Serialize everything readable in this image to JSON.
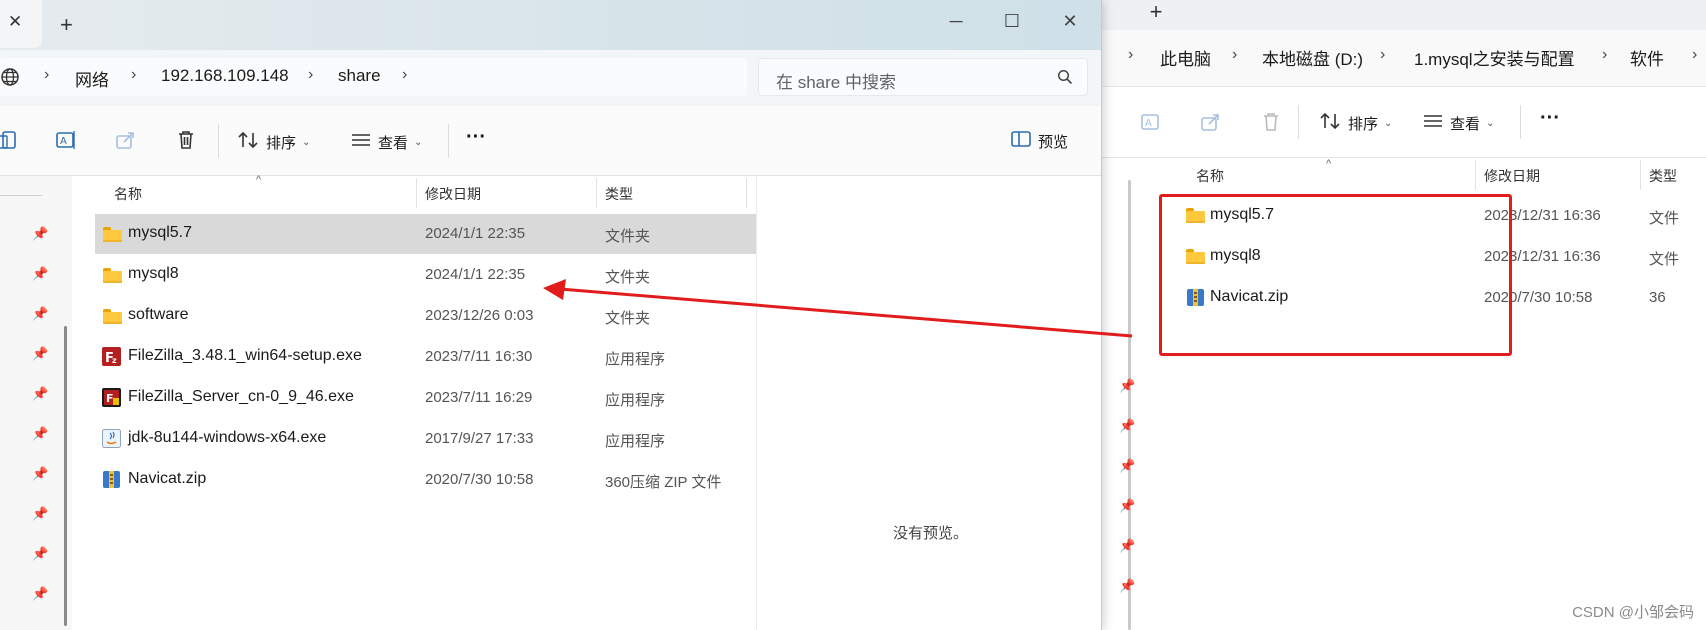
{
  "right_window": {
    "tab_add": "+",
    "breadcrumbs": [
      "此电脑",
      "本地磁盘 (D:)",
      "1.mysql之安装与配置",
      "软件"
    ],
    "toolbar": {
      "sort_label": "排序",
      "view_label": "查看",
      "more_label": "···"
    },
    "columns": {
      "name": "名称",
      "date": "修改日期",
      "type": "类型"
    },
    "rows": [
      {
        "name": "mysql5.7",
        "date": "2023/12/31 16:36",
        "type": "文件",
        "icon": "folder-icon"
      },
      {
        "name": "mysql8",
        "date": "2023/12/31 16:36",
        "type": "文件",
        "icon": "folder-icon"
      },
      {
        "name": "Navicat.zip",
        "date": "2020/7/30 10:58",
        "type": "36",
        "icon": "zip-icon"
      }
    ]
  },
  "left_window": {
    "tab_close": "✕",
    "tab_add": "+",
    "window_controls": {
      "minimize": "─",
      "maximize": "☐",
      "close": "✕"
    },
    "breadcrumbs": [
      "网络",
      "192.168.109.148",
      "share"
    ],
    "search": {
      "placeholder": "在 share 中搜索"
    },
    "toolbar": {
      "sort_label": "排序",
      "view_label": "查看",
      "more_label": "···",
      "preview_label": "预览"
    },
    "columns": {
      "name": "名称",
      "date": "修改日期",
      "type": "类型"
    },
    "rows": [
      {
        "name": "mysql5.7",
        "date": "2024/1/1 22:35",
        "type": "文件夹",
        "icon": "folder-icon",
        "selected": true
      },
      {
        "name": "mysql8",
        "date": "2024/1/1 22:35",
        "type": "文件夹",
        "icon": "folder-icon"
      },
      {
        "name": "software",
        "date": "2023/12/26 0:03",
        "type": "文件夹",
        "icon": "folder-icon"
      },
      {
        "name": "FileZilla_3.48.1_win64-setup.exe",
        "date": "2023/7/11 16:30",
        "type": "应用程序",
        "icon": "filezilla-icon"
      },
      {
        "name": "FileZilla_Server_cn-0_9_46.exe",
        "date": "2023/7/11 16:29",
        "type": "应用程序",
        "icon": "filezilla-server-icon"
      },
      {
        "name": "jdk-8u144-windows-x64.exe",
        "date": "2017/9/27 17:33",
        "type": "应用程序",
        "icon": "java-installer-icon"
      },
      {
        "name": "Navicat.zip",
        "date": "2020/7/30 10:58",
        "type": "360压缩 ZIP 文件",
        "icon": "zip-icon"
      }
    ],
    "preview_text": "没有预览。"
  },
  "annotation": {
    "color": "#e21c1c"
  },
  "watermark": "CSDN @小邹会码"
}
